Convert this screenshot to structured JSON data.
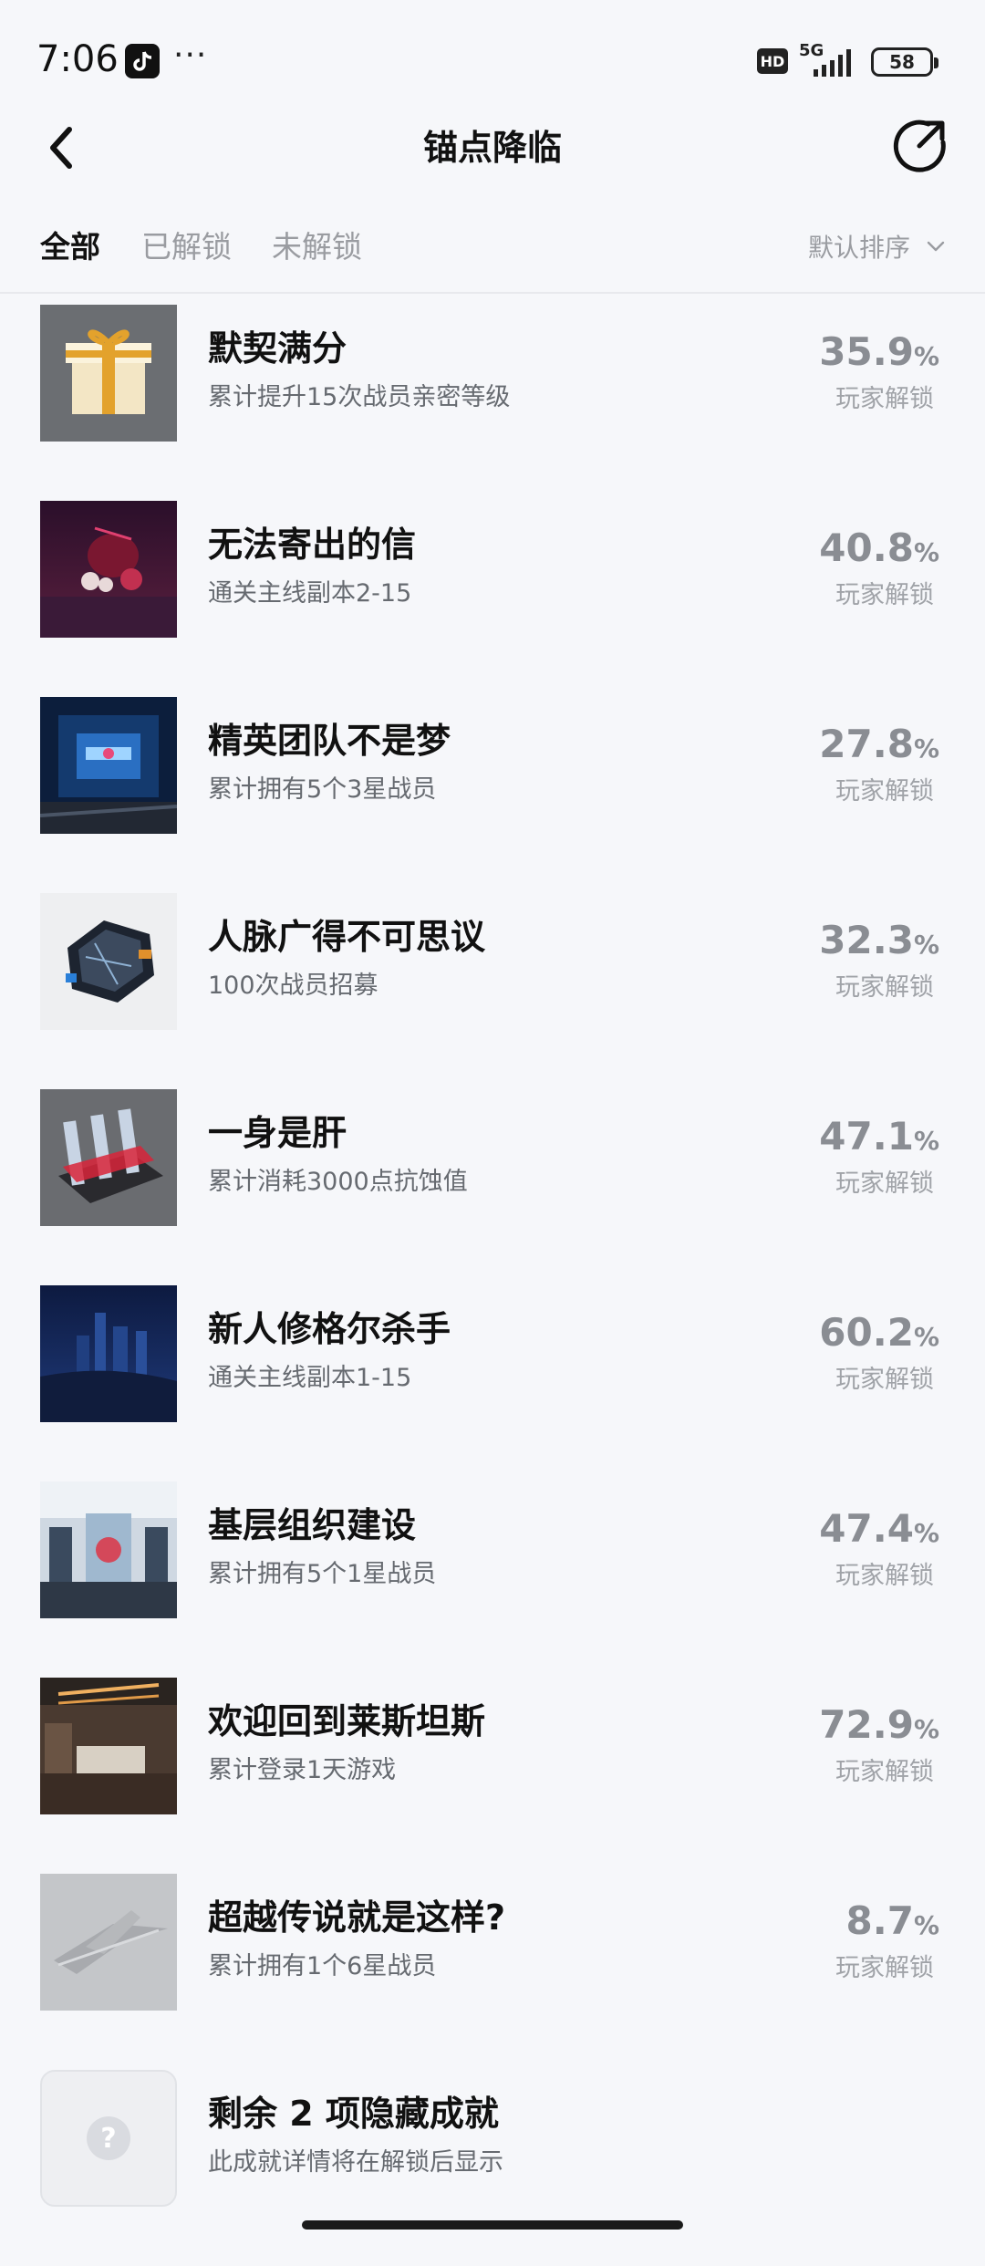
{
  "status_bar": {
    "time": "7:06",
    "dots": "···",
    "hd": "HD",
    "network": "5G",
    "battery": "58"
  },
  "header": {
    "title": "锚点降临",
    "back_icon": "chevron-left-icon",
    "share_icon": "share-icon"
  },
  "tabs": {
    "all": "全部",
    "unlocked": "已解锁",
    "locked": "未解锁",
    "sort": "默认排序"
  },
  "achievements": [
    {
      "title": "默契满分",
      "desc": "累计提升15次战员亲密等级",
      "percent": "35.9",
      "unlock_label": "玩家解锁"
    },
    {
      "title": "无法寄出的信",
      "desc": "通关主线副本2-15",
      "percent": "40.8",
      "unlock_label": "玩家解锁"
    },
    {
      "title": "精英团队不是梦",
      "desc": "累计拥有5个3星战员",
      "percent": "27.8",
      "unlock_label": "玩家解锁"
    },
    {
      "title": "人脉广得不可思议",
      "desc": "100次战员招募",
      "percent": "32.3",
      "unlock_label": "玩家解锁"
    },
    {
      "title": "一身是肝",
      "desc": "累计消耗3000点抗蚀值",
      "percent": "47.1",
      "unlock_label": "玩家解锁"
    },
    {
      "title": "新人修格尔杀手",
      "desc": "通关主线副本1-15",
      "percent": "60.2",
      "unlock_label": "玩家解锁"
    },
    {
      "title": "基层组织建设",
      "desc": "累计拥有5个1星战员",
      "percent": "47.4",
      "unlock_label": "玩家解锁"
    },
    {
      "title": "欢迎回到莱斯坦斯",
      "desc": "累计登录1天游戏",
      "percent": "72.9",
      "unlock_label": "玩家解锁"
    },
    {
      "title": "超越传说就是这样?",
      "desc": "累计拥有1个6星战员",
      "percent": "8.7",
      "unlock_label": "玩家解锁"
    }
  ],
  "percent_sign": "%",
  "hidden": {
    "title": "剩余 2 项隐藏成就",
    "desc": "此成就详情将在解锁后显示",
    "icon_glyph": "?"
  }
}
